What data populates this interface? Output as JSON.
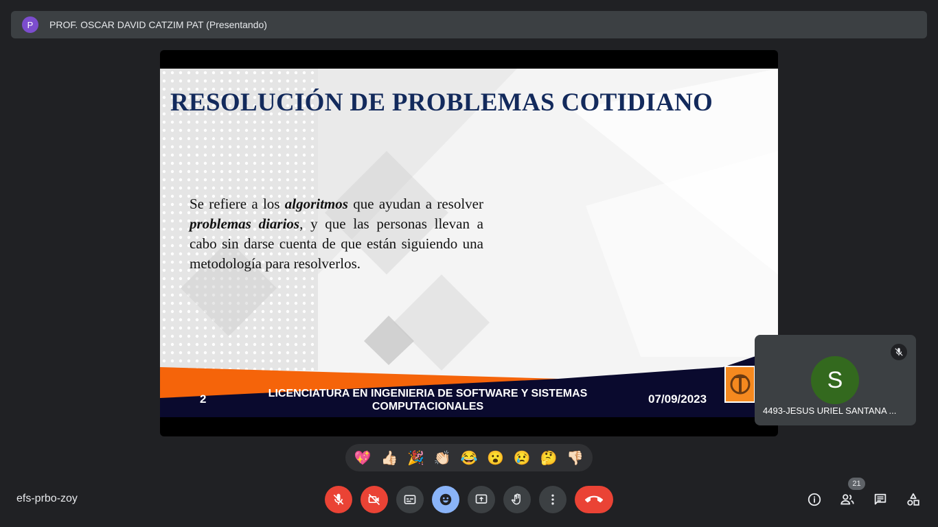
{
  "presenter": {
    "avatar_letter": "P",
    "label": "PROF. OSCAR DAVID CATZIM PAT (Presentando)",
    "avatar_color": "#7c4dce"
  },
  "slide": {
    "title": "RESOLUCIÓN DE PROBLEMAS COTIDIANO",
    "body_parts": {
      "p1": "Se refiere a los ",
      "b1": "algoritmos",
      "p2": " que ayudan a resolver ",
      "b2": "problemas diarios",
      "p3": ", y que las personas llevan a cabo sin darse cuenta de que están siguiendo una metodología para resolverlos."
    },
    "footer": {
      "page_number": "2",
      "program": "LICENCIATURA EN INGENIERIA DE SOFTWARE Y SISTEMAS COMPUTACIONALES",
      "date": "07/09/2023"
    },
    "colors": {
      "title": "#132a5c",
      "band_orange": "#f5640a",
      "band_navy": "#0a0a2e"
    }
  },
  "participant": {
    "avatar_letter": "S",
    "name": "4493-JESUS URIEL SANTANA ...",
    "avatar_color": "#33691e",
    "muted": true
  },
  "reactions": [
    "💖",
    "👍🏻",
    "🎉",
    "👏🏻",
    "😂",
    "😮",
    "😢",
    "🤔",
    "👎🏻"
  ],
  "meeting": {
    "code": "efs-prbo-zoy",
    "participant_count": "21"
  },
  "controls": {
    "mic": "mic-off-icon",
    "camera": "camera-off-icon",
    "captions": "captions-icon",
    "emoji": "emoji-icon",
    "present": "present-screen-icon",
    "raise_hand": "raise-hand-icon",
    "more": "more-options-icon",
    "end_call": "end-call-icon",
    "info": "info-icon",
    "people": "people-icon",
    "chat": "chat-icon",
    "activities": "activities-icon"
  },
  "colors": {
    "background": "#202124",
    "danger": "#ea4335",
    "accent": "#8ab4f8"
  }
}
